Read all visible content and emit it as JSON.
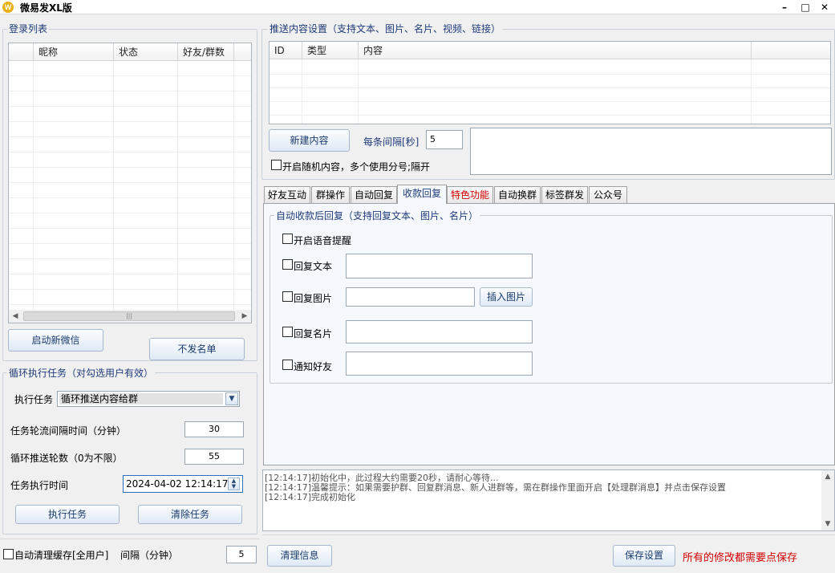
{
  "window": {
    "icon_letter": "W",
    "title": "微易发XL版",
    "min_glyph": "–",
    "max_glyph": "□",
    "close_glyph": "✕"
  },
  "login": {
    "group_title": "登录列表",
    "columns": [
      "",
      "昵称",
      "状态",
      "好友/群数"
    ],
    "start_button": "启动新微信",
    "blacklist_button": "不发名单",
    "scroll_grip": "|||"
  },
  "loop_task": {
    "group_title": "循环执行任务（对勾选用户有效）",
    "task_label": "执行任务",
    "task_value": "循环推送内容给群",
    "interval_label": "任务轮流间隔时间（分钟）",
    "interval_value": "30",
    "rounds_label": "循环推送轮数（0为不限）",
    "rounds_value": "55",
    "time_label": "任务执行时间",
    "time_value": "2024-04-02 12:14:17",
    "run_button": "执行任务",
    "clear_button": "清除任务"
  },
  "bottom_left": {
    "auto_clear_label": "自动清理缓存[全用户]",
    "interval_label": "间隔（分钟）",
    "interval_value": "5"
  },
  "push": {
    "group_title": "推送内容设置（支持文本、图片、名片、视频、链接）",
    "columns": [
      "ID",
      "类型",
      "内容",
      ""
    ],
    "new_button": "新建内容",
    "interval_label": "每条间隔[秒]",
    "interval_value": "5",
    "random_label": "开启随机内容，多个使用分号;隔开"
  },
  "tabs": [
    {
      "label": "好友互动"
    },
    {
      "label": "群操作"
    },
    {
      "label": "自动回复"
    },
    {
      "label": "收款回复"
    },
    {
      "label": "特色功能"
    },
    {
      "label": "自动换群"
    },
    {
      "label": "标签群发"
    },
    {
      "label": "公众号"
    }
  ],
  "payment": {
    "group_title": "自动收款后回复（支持回复文本、图片、名片）",
    "voice_label": "开启语音提醒",
    "reply_text_label": "回复文本",
    "reply_text_value": "",
    "reply_image_label": "回复图片",
    "reply_image_value": "",
    "insert_image_button": "插入图片",
    "reply_card_label": "回复名片",
    "reply_card_value": "",
    "notify_label": "通知好友",
    "notify_value": ""
  },
  "log": {
    "lines": [
      "[12:14:17]初始化中，此过程大约需要20秒，请耐心等待...",
      "[12:14:17]温馨提示：如果需要护群、回复群消息、新人进群等，需在群操作里面开启【处理群消息】并点击保存设置",
      "[12:14:17]完成初始化"
    ]
  },
  "footer": {
    "clear_log_button": "清理信息",
    "save_button": "保存设置",
    "save_notice": "所有的修改都需要点保存"
  },
  "colors": {
    "accent_blue": "#1e3a7a",
    "alert_red": "#d40000",
    "window_bg": "#f0f0f0"
  }
}
